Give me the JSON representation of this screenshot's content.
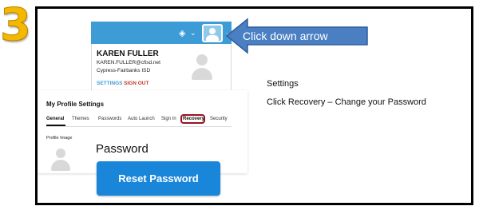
{
  "step_number": "3",
  "dropdown": {
    "user_name": "KAREN FULLER",
    "user_email": "KAREN.FULLER@cfisd.net",
    "user_org": "Cypress-Fairbanks ISD",
    "settings_link": "SETTINGS",
    "signout_link": "SIGN OUT"
  },
  "callout": {
    "text": "Click down arrow"
  },
  "settings_page": {
    "title": "My Profile Settings",
    "tabs": [
      "General",
      "Themes",
      "Passwords",
      "Auto Launch",
      "Sign In",
      "Recovery",
      "Security"
    ],
    "active_tab": "General",
    "highlighted_tab": "Recovery",
    "profile_image_label": "Profile Image",
    "password_heading": "Password",
    "reset_button": "Reset Password"
  },
  "instructions": {
    "heading": "Settings",
    "body": "Click Recovery – Change your Password"
  },
  "colors": {
    "accent_blue": "#3d9cd6",
    "button_blue": "#1a86d9",
    "highlight_red": "#9e1020",
    "step_yellow": "#f5b800"
  }
}
